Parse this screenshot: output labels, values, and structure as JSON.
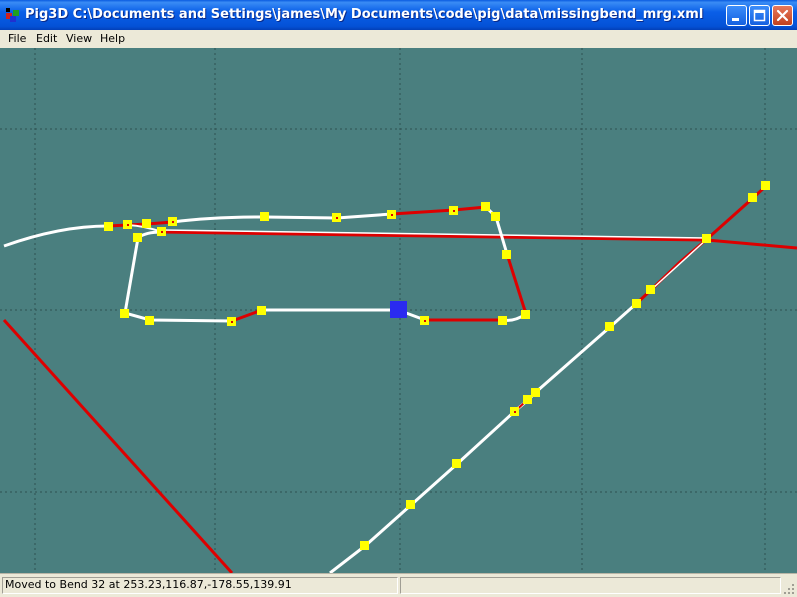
{
  "window": {
    "title": "Pig3D C:\\Documents and Settings\\james\\My Documents\\code\\pig\\data\\missingbend_mrg.xml",
    "app_icon": "pig3d-app-icon",
    "controls": [
      "minimize-icon",
      "maximize-icon",
      "close-icon"
    ]
  },
  "menu": {
    "items": [
      {
        "label": "File"
      },
      {
        "label": "Edit"
      },
      {
        "label": "View"
      },
      {
        "label": "Help"
      }
    ]
  },
  "canvas": {
    "background_color": "#4a7f7f",
    "grid_color": "#2e5050",
    "track_colors": {
      "white": "#ffffff",
      "red": "#dd0000"
    },
    "node_color": "#ffff00",
    "selected_node_color": "#2a2af0"
  },
  "status": {
    "message": "Moved to Bend 32 at 253.23,116.87,-178.55,139.91"
  }
}
